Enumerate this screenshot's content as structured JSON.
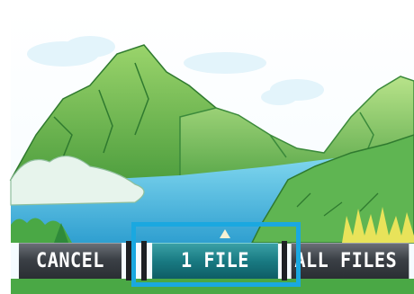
{
  "options": {
    "cancel_label": "CANCEL",
    "one_file_label": "1 FILE",
    "all_files_label": "ALL FILES",
    "selected": "1 FILE"
  },
  "colors": {
    "selection_border": "#1aa8e0",
    "selected_button": "#197a82",
    "button": "#3b4046",
    "label": "#ffffff"
  }
}
